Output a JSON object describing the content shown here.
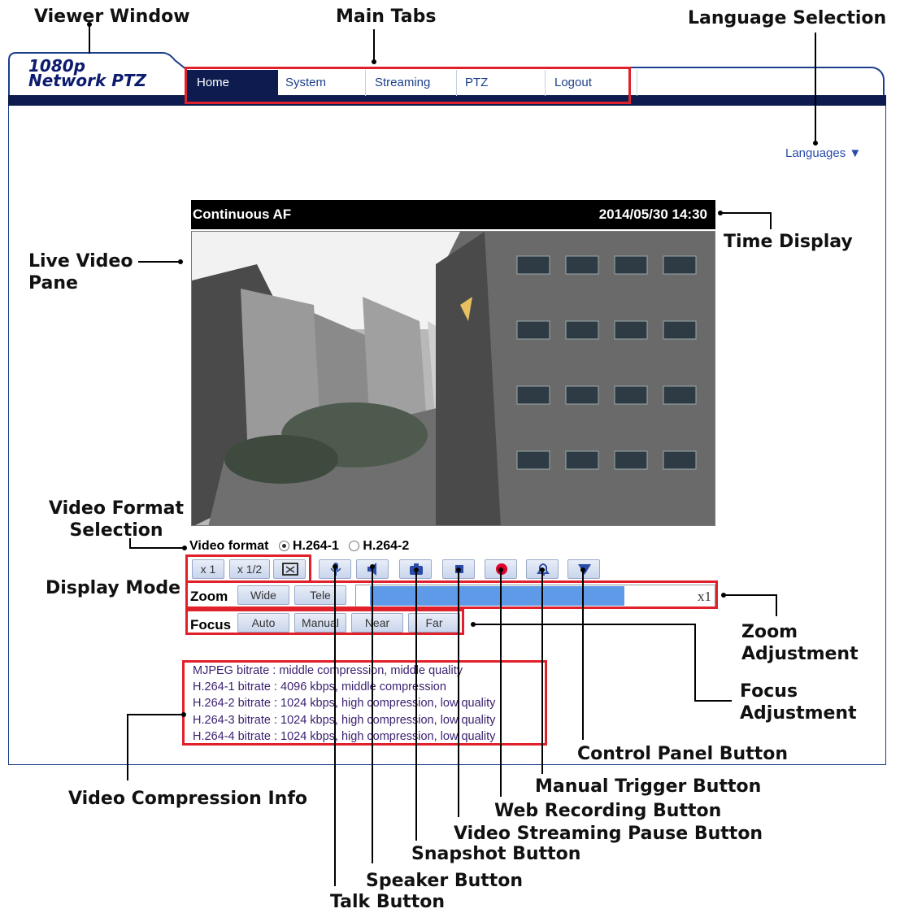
{
  "annotations": {
    "viewer_window": "Viewer Window",
    "main_tabs": "Main Tabs",
    "language_selection": "Language Selection",
    "live_video_pane_1": "Live Video",
    "live_video_pane_2": "Pane",
    "time_display": "Time Display",
    "video_format_selection_1": "Video Format",
    "video_format_selection_2": "Selection",
    "display_mode": "Display Mode",
    "zoom_adjustment_1": "Zoom",
    "zoom_adjustment_2": "Adjustment",
    "focus_adjustment_1": "Focus",
    "focus_adjustment_2": "Adjustment",
    "control_panel_button": "Control Panel Button",
    "manual_trigger_button": "Manual Trigger Button",
    "web_recording_button": "Web Recording Button",
    "video_streaming_pause_button": "Video Streaming Pause Button",
    "snapshot_button": "Snapshot Button",
    "speaker_button": "Speaker Button",
    "talk_button": "Talk Button",
    "video_compression_info": "Video Compression Info"
  },
  "logo": {
    "line1": "1080p",
    "line2": "Network PTZ"
  },
  "tabs": [
    "Home",
    "System",
    "Streaming",
    "PTZ",
    "Logout"
  ],
  "active_tab": "Home",
  "languages_label": "Languages ▼",
  "video": {
    "focus_mode": "Continuous AF",
    "timestamp": "2014/05/30 14:30"
  },
  "video_format": {
    "label": "Video format",
    "options": [
      "H.264-1",
      "H.264-2"
    ],
    "selected": "H.264-1"
  },
  "display_mode": {
    "x1": "x 1",
    "x_half": "x 1/2"
  },
  "icons": [
    "fullscreen-icon",
    "microphone-icon",
    "speaker-icon",
    "camera-icon",
    "stop-icon",
    "record-icon",
    "bell-icon",
    "triangle-down-icon"
  ],
  "zoom": {
    "label": "Zoom",
    "wide": "Wide",
    "tele": "Tele",
    "value": "x1",
    "level": 0.85
  },
  "focus": {
    "label": "Focus",
    "auto": "Auto",
    "manual": "Manual",
    "near": "Near",
    "far": "Far"
  },
  "compression_info": [
    "MJPEG bitrate : middle compression, middle quality",
    "H.264-1 bitrate : 4096 kbps, middle compression",
    "H.264-2 bitrate : 1024 kbps, high compression, low quality",
    "H.264-3 bitrate : 1024 kbps, high compression, low quality",
    "H.264-4 bitrate : 1024 kbps, high compression, low quality"
  ],
  "colors": {
    "navy": "#0d1b4f",
    "highlight": "#e0202a",
    "zoom_fill": "#5f9ae8",
    "record": "#e0002a"
  }
}
